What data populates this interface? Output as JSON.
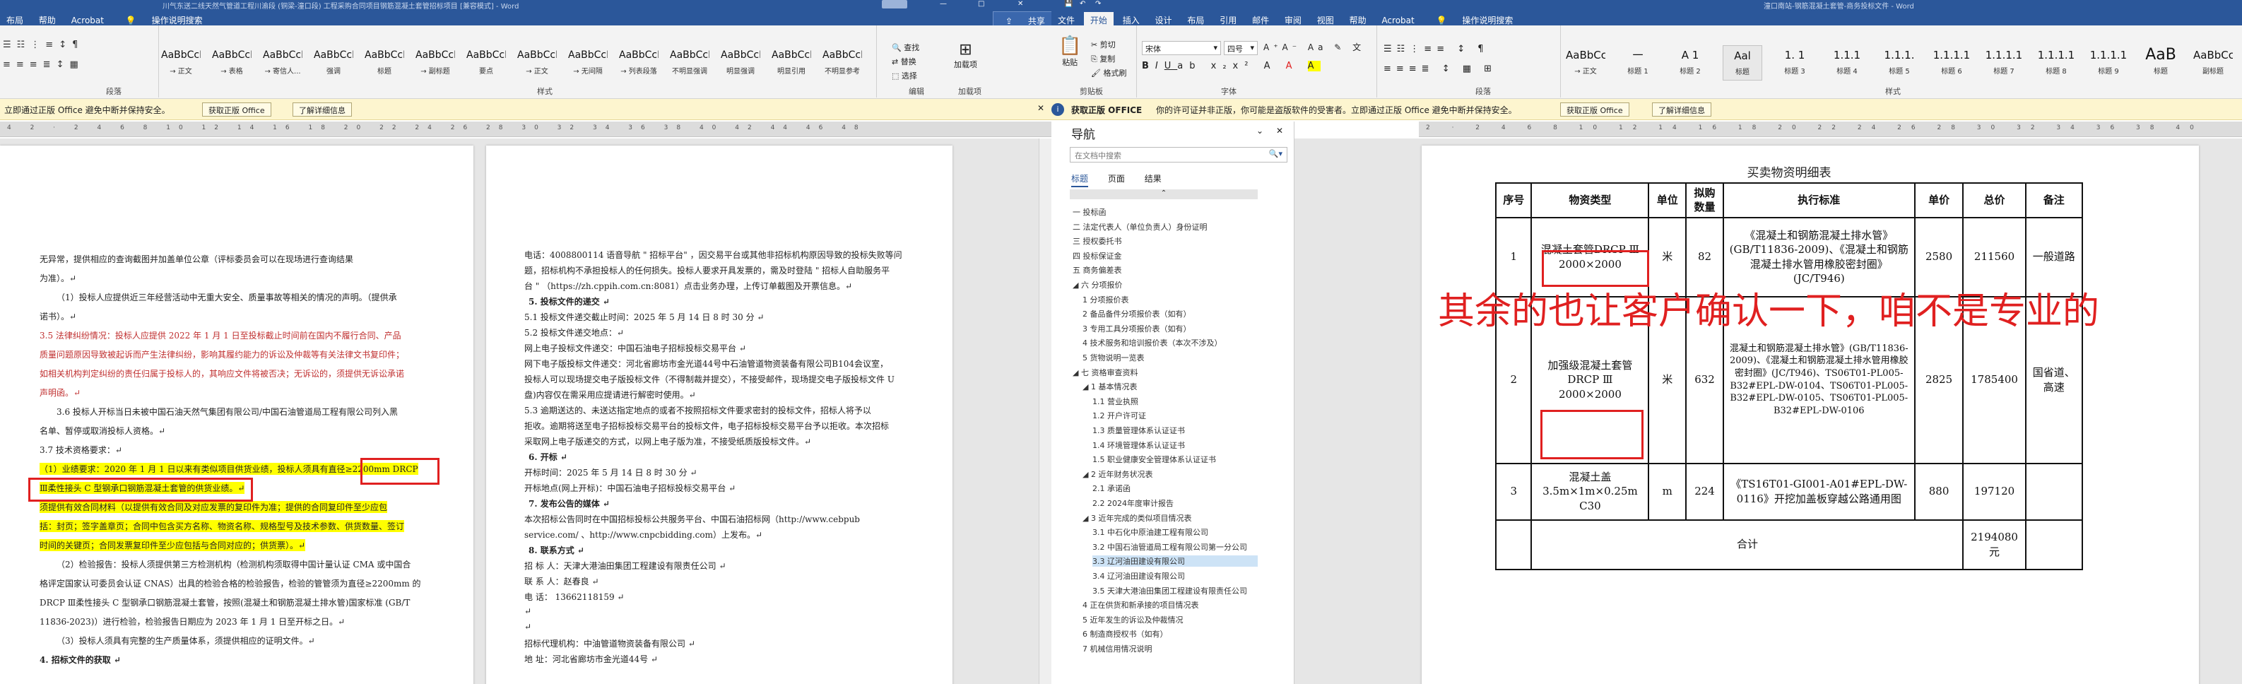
{
  "left_window": {
    "title": "川气东送二线天然气管道工程川渝段 (铜梁-潼口段) 工程采购合同项目钢筋混凝土套管招标项目 [兼容模式] - Word",
    "tabs": [
      "布局",
      "帮助",
      "Acrobat",
      "操作说明搜索"
    ],
    "tell_me": "操作说明搜索",
    "share_label": "共享",
    "styles": [
      {
        "sample": "AaBbCcI",
        "name": "→ 正文"
      },
      {
        "sample": "AaBbCcI",
        "name": "→ 表格"
      },
      {
        "sample": "AaBbCcI",
        "name": "→ 寄信人..."
      },
      {
        "sample": "AaBbCcD",
        "name": "强调"
      },
      {
        "sample": "AaBbCcD",
        "name": "标题"
      },
      {
        "sample": "AaBbCcD",
        "name": "→ 副标题"
      },
      {
        "sample": "AaBbCcD",
        "name": "要点"
      },
      {
        "sample": "AaBbCcDi",
        "name": "→ 正文"
      },
      {
        "sample": "AaBbCcDd",
        "name": "→ 无间隔"
      },
      {
        "sample": "AaBbCcDd",
        "name": "→ 列表段落"
      },
      {
        "sample": "AaBbCcDd",
        "name": "不明显强调"
      },
      {
        "sample": "AaBbCcDd",
        "name": "明显强调"
      },
      {
        "sample": "AaBbCcDd",
        "name": "明显引用"
      },
      {
        "sample": "AaBbCcD",
        "name": "不明显参考"
      }
    ],
    "group_labels": {
      "paragraph": "段落",
      "styles": "样式",
      "editing": "编辑",
      "addins": "加载项"
    },
    "editing_items": [
      "查找",
      "替换",
      "选择"
    ],
    "addin_item": "加载项",
    "infobar": {
      "text": "立即通过正版 Office 避免中断并保持安全。",
      "btn1": "获取正版 Office",
      "btn2": "了解详细信息"
    },
    "page1_lines": [
      "无异常，提供相应的查询截图并加盖单位公章（评标委员会可以在现场进行查询结果",
      "为准）。↵",
      "（1）投标人应提供近三年经营活动中无重大安全、质量事故等相关的情况的声明。（提供承",
      "诺书）。↵",
      "3.5 法律纠纷情况：投标人应提供 2022 年 1 月 1 日至投标截止时间前在国内不履行合同、产品",
      "质量问题原因导致被起诉而产生法律纠纷，影响其履约能力的诉讼及仲裁等有关法律文书复印件；",
      "如相关机构判定纠纷的责任归属于投标人的，其响应文件将被否决；无诉讼的，须提供无诉讼承诺",
      "声明函。↵",
      "3.6 投标人开标当日未被中国石油天然气集团有限公司/中国石油管道局工程有限公司列入黑",
      "名单、暂停或取消投标人资格。↵",
      "3.7 技术资格要求：↵",
      "（1）业绩要求：2020 年 1 月 1 日以来有类似项目供货业绩，投标人须具有直径≥2200mm DRCP",
      "Ⅲ柔性接头 C 型钢承口钢筋混凝土套管的供货业绩。↵",
      "须提供有效合同材料（以提供有效合同及对应发票的复印件为准；提供的合同复印件至少应包",
      "括：封页；签字盖章页；合同中包含买方名称、物资名称、规格型号及技术参数、供货数量、签订",
      "时间的关键页；合同发票复印件至少应包括与合同对应的；供货票）。↵",
      "（2）检验报告：投标人须提供第三方检测机构（检测机构须取得中国计量认证 CMA 或中国合",
      "格评定国家认可委员会认证 CNAS）出具的检验合格的检验报告，检验的管管须为直径≥2200mm 的",
      "DRCP Ⅲ柔性接头 C 型钢承口钢筋混凝土套管，按照(混凝土和钢筋混凝土排水管)国家标准 (GB/T",
      "11836-2023)）进行检验，检验报告日期应为 2023 年 1 月 1 日至开标之日。↵",
      "（3）投标人须具有完整的生产质量体系，须提供相应的证明文件。↵",
      "4. 招标文件的获取 ↵"
    ],
    "page2_lines": [
      "电话：4008800114 语音导航 \" 招标平台\" ，因交易平台或其他非招标机构原因导致的投标失败等问",
      "题，招标机构不承担投标人的任何损失。投标人要求开具发票的，需及时登陆 \" 招标人自助服务平",
      "台 \" （https://zh.cppih.com.cn:8081）点击业务办理，上传订单截图及开票信息。↵",
      "5. 投标文件的递交 ↵",
      "5.1 投标文件递交截止时间：2025 年 5 月 14 日 8 时 30 分 ↵",
      "5.2 投标文件递交地点：↵",
      "网上电子投标文件递交：中国石油电子招标投标交易平台 ↵",
      "网下电子版投标文件递交：河北省廊坊市金光道44号中石油管道物资装备有限公司B104会议室，",
      "投标人可以现场提交电子版投标文件（不得制裁并提交），不接受邮件，现场提交电子版投标文件 U",
      "盘)内容仅在需采用应提请进行解密时使用。↵",
      "5.3 逾期送达的、未送达指定地点的或者不按照招标文件要求密封的投标文件，招标人将予以",
      "拒收。逾期将送至电子招标投标交易平台的投标文件，电子招标投标交易平台予以拒收。本次招标",
      "采取网上电子版递交的方式，以网上电子版为准，不接受纸质版投标文件。↵",
      "6. 开标 ↵",
      "开标时间：2025 年 5 月 14 日 8 时 30 分 ↵",
      "开标地点(网上开标)：中国石油电子招标投标交易平台 ↵",
      "7. 发布公告的媒体 ↵",
      "本次招标公告同时在中国招标投标公共服务平台、中国石油招标网（http://www.cebpub",
      "service.com/ 、http://www.cnpcbidding.com）上发布。↵",
      "8. 联系方式 ↵",
      "招 标 人：天津大港油田集团工程建设有限责任公司 ↵",
      "联 系 人：赵春良 ↵",
      "电    话： 13662118159 ↵",
      "↵",
      "↵",
      "招标代理机构：中油管道物资装备有限公司 ↵",
      "地    址：河北省廊坊市金光道44号 ↵"
    ],
    "annotation": "其余的也让客户确认一下，咱不是专业的"
  },
  "right_window": {
    "title": "潼口南站-钢筋混凝土套管-商务投标文件 - Word",
    "tabs": [
      "文件",
      "开始",
      "插入",
      "设计",
      "布局",
      "引用",
      "邮件",
      "审阅",
      "视图",
      "帮助",
      "Acrobat",
      "操作说明搜索"
    ],
    "active_tab": "开始",
    "clipboard": {
      "paste": "粘贴",
      "cut": "剪切",
      "copy": "复制",
      "format_painter": "格式刷",
      "label": "剪贴板"
    },
    "font": {
      "name": "宋体",
      "size": "四号",
      "label": "字体"
    },
    "paragraph_label": "段落",
    "styles_label": "样式",
    "styles": [
      {
        "sample": "AaBbCcDd",
        "name": "→ 正文"
      },
      {
        "sample": "一",
        "name": "标题 1"
      },
      {
        "sample": "A 1",
        "name": "标题 2"
      },
      {
        "sample": "Aal",
        "name": "标题"
      },
      {
        "sample": "1. 1",
        "name": "标题 3"
      },
      {
        "sample": "1.1.1",
        "name": "标题 4"
      },
      {
        "sample": "1.1.1.",
        "name": "标题 5"
      },
      {
        "sample": "1.1.1.1",
        "name": "标题 6"
      },
      {
        "sample": "1.1.1.1",
        "name": "标题 7"
      },
      {
        "sample": "1.1.1.1",
        "name": "标题 8"
      },
      {
        "sample": "1.1.1.1",
        "name": "标题 9"
      },
      {
        "sample": "AaB",
        "name": "标题"
      },
      {
        "sample": "AaBbCc",
        "name": "副标题"
      }
    ],
    "infobar": {
      "title": "获取正版 OFFICE",
      "text": "你的许可证并非正版，你可能是盗版软件的受害者。立即通过正版 Office 避免中断并保持安全。",
      "btn1": "获取正版 Office",
      "btn2": "了解详细信息"
    },
    "nav": {
      "title": "导航",
      "search_placeholder": "在文档中搜索",
      "tabs": [
        "标题",
        "页面",
        "结果"
      ],
      "items": [
        {
          "text": "一 投标函",
          "level": 0
        },
        {
          "text": "二 法定代表人（单位负责人）身份证明",
          "level": 0
        },
        {
          "text": "三 授权委托书",
          "level": 0
        },
        {
          "text": "四 投标保证金",
          "level": 0
        },
        {
          "text": "五 商务偏差表",
          "level": 0
        },
        {
          "text": "◢ 六 分项报价",
          "level": 0
        },
        {
          "text": "1 分项报价表",
          "level": 1
        },
        {
          "text": "2 备品备件分项报价表（如有）",
          "level": 1
        },
        {
          "text": "3 专用工具分项报价表（如有）",
          "level": 1
        },
        {
          "text": "4 技术服务和培训报价表（本次不涉及）",
          "level": 1
        },
        {
          "text": "5 货物说明一览表",
          "level": 1
        },
        {
          "text": "◢ 七 资格审查资料",
          "level": 0
        },
        {
          "text": "◢ 1 基本情况表",
          "level": 1
        },
        {
          "text": "1.1 营业执照",
          "level": 2
        },
        {
          "text": "1.2 开户许可证",
          "level": 2
        },
        {
          "text": "1.3 质量管理体系认证证书",
          "level": 2
        },
        {
          "text": "1.4 环境管理体系认证证书",
          "level": 2
        },
        {
          "text": "1.5 职业健康安全管理体系认证证书",
          "level": 2
        },
        {
          "text": "◢ 2 近年财务状况表",
          "level": 1
        },
        {
          "text": "2.1 承诺函",
          "level": 2
        },
        {
          "text": "2.2 2024年度审计报告",
          "level": 2
        },
        {
          "text": "◢ 3 近年完成的类似项目情况表",
          "level": 1
        },
        {
          "text": "3.1 中石化中原油建工程有限公司",
          "level": 2
        },
        {
          "text": "3.2 中国石油管道局工程有限公司第一分公司",
          "level": 2
        },
        {
          "text": "3.3 辽河油田建设有限公司",
          "level": 2,
          "selected": true
        },
        {
          "text": "3.4 辽河油田建设有限公司",
          "level": 2
        },
        {
          "text": "3.5 天津大港油田集团工程建设有限责任公司",
          "level": 2
        },
        {
          "text": "4 正在供货和新承接的项目情况表",
          "level": 1
        },
        {
          "text": "5 近年发生的诉讼及仲裁情况",
          "level": 1
        },
        {
          "text": "6 制造商授权书（如有）",
          "level": 1
        },
        {
          "text": "7 机械信用情况说明",
          "level": 1
        }
      ]
    },
    "doc": {
      "table_title": "买卖物资明细表",
      "headers": [
        "序号",
        "物资类型",
        "单位",
        "拟购数量",
        "执行标准",
        "单价",
        "总价",
        "备注"
      ],
      "rows": [
        {
          "no": "1",
          "type": "混凝土套管DRCP Ⅲ 2000×2000",
          "unit": "米",
          "qty": "82",
          "std": "《混凝土和钢筋混凝土排水管》(GB/T11836-2009)、《混凝土和钢筋混凝土排水管用橡胶密封圈》(JC/T946)",
          "price": "2580",
          "total": "211560",
          "note": "一般道路"
        },
        {
          "no": "2",
          "type": "加强级混凝土套管DRCP Ⅲ 2000×2000",
          "unit": "米",
          "qty": "632",
          "std": "混凝土和钢筋混凝土排水管》(GB/T11836-2009)、《混凝土和钢筋混凝土排水管用橡胶密封圈》(JC/T946)、TS06T01-PL005-B32#EPL-DW-0104、TS06T01-PL005-B32#EPL-DW-0105、TS06T01-PL005-B32#EPL-DW-0106",
          "price": "2825",
          "total": "1785400",
          "note": "国省道、高速"
        },
        {
          "no": "3",
          "type": "混凝土盖 3.5m×1m×0.25m C30",
          "unit": "m",
          "qty": "224",
          "std": "《TS16T01-GI001-A01#EPL-DW-0116》开挖加盖板穿越公路通用图",
          "price": "880",
          "total": "197120",
          "note": ""
        }
      ],
      "total_label": "合计",
      "total_value": "2194080元"
    }
  },
  "colors": {
    "word_blue": "#2b579a",
    "highlight": "#ffff00",
    "annotation_red": "#e02020",
    "infobar": "#fdf5cf"
  }
}
